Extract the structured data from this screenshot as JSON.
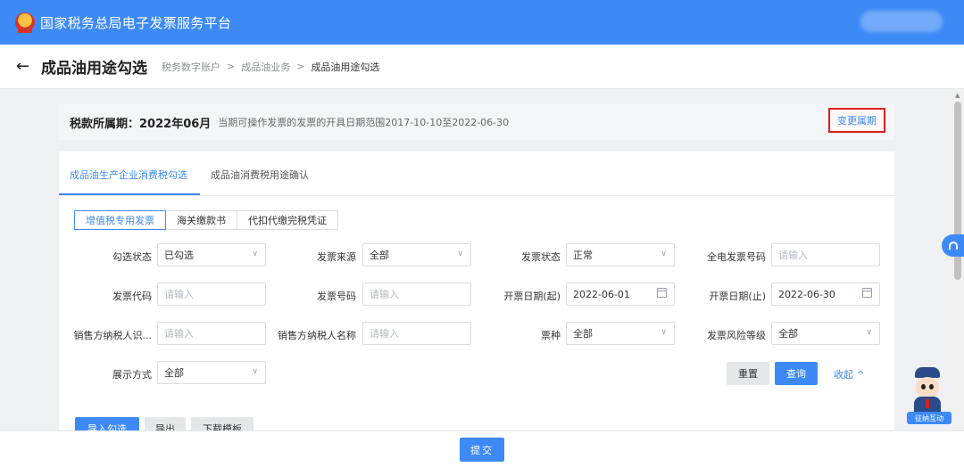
{
  "header": {
    "title": "国家税务总局电子发票服务平台",
    "logo_icon": "tax-emblem-icon",
    "brand_color": "#3d8af7"
  },
  "page": {
    "back_icon": "back-arrow-icon",
    "title": "成品油用途勾选",
    "breadcrumb": [
      "税务数字账户",
      "成品油业务",
      "成品油用途勾选"
    ],
    "breadcrumb_separator": ">"
  },
  "period": {
    "label": "税款所属期：",
    "value": "2022年06月",
    "range_text": "当期可操作发票的发票的开具日期范围2017-10-10至2022-06-30",
    "change_label": "变更属期"
  },
  "tabs": [
    {
      "label": "成品油生产企业消费税勾选",
      "active": true
    },
    {
      "label": "成品油消费税用途确认",
      "active": false
    }
  ],
  "segments": [
    {
      "label": "增值税专用发票",
      "active": true
    },
    {
      "label": "海关缴款书",
      "active": false
    },
    {
      "label": "代扣代缴完税凭证",
      "active": false
    }
  ],
  "filters": {
    "check_status": {
      "label": "勾选状态",
      "value": "已勾选"
    },
    "invoice_source": {
      "label": "发票来源",
      "value": "全部"
    },
    "invoice_status": {
      "label": "发票状态",
      "value": "正常"
    },
    "einvoice_number": {
      "label": "全电发票号码",
      "placeholder": "请输入"
    },
    "invoice_code": {
      "label": "发票代码",
      "placeholder": "请输入"
    },
    "invoice_number": {
      "label": "发票号码",
      "placeholder": "请输入"
    },
    "date_start": {
      "label": "开票日期(起)",
      "value": "2022-06-01"
    },
    "date_end": {
      "label": "开票日期(止)",
      "value": "2022-06-30"
    },
    "seller_tax_id": {
      "label": "销售方纳税人识...",
      "placeholder": "请输入"
    },
    "seller_name": {
      "label": "销售方纳税人名称",
      "placeholder": "请输入"
    },
    "ticket_type": {
      "label": "票种",
      "value": "全部"
    },
    "risk_level": {
      "label": "发票风险等级",
      "value": "全部"
    },
    "display_mode": {
      "label": "展示方式",
      "value": "全部"
    }
  },
  "actions": {
    "reset": "重置",
    "query": "查询",
    "collapse": "收起 ^",
    "import": "导入勾选",
    "export": "导出",
    "template": "下载模板",
    "submit": "提交"
  },
  "assistant": {
    "badge": "征纳互动"
  }
}
